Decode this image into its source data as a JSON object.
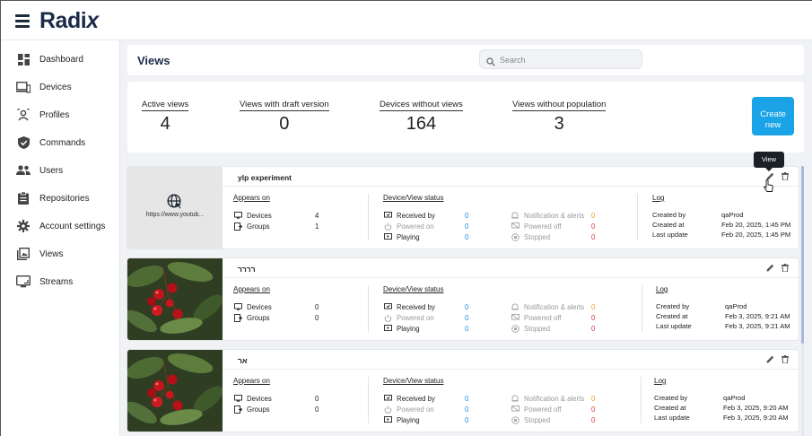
{
  "app": {
    "logo": "Radix"
  },
  "sidebar": {
    "items": [
      {
        "label": "Dashboard",
        "icon": "dashboard-icon"
      },
      {
        "label": "Devices",
        "icon": "devices-icon"
      },
      {
        "label": "Profiles",
        "icon": "profiles-icon"
      },
      {
        "label": "Commands",
        "icon": "shield-check-icon"
      },
      {
        "label": "Users",
        "icon": "users-icon"
      },
      {
        "label": "Repositories",
        "icon": "clipboard-icon"
      },
      {
        "label": "Account settings",
        "icon": "gear-icon"
      },
      {
        "label": "Views",
        "icon": "views-icon"
      },
      {
        "label": "Streams",
        "icon": "streams-icon"
      }
    ]
  },
  "header": {
    "title": "Views",
    "search_placeholder": "Search"
  },
  "stats": [
    {
      "label": "Active views",
      "value": "4"
    },
    {
      "label": "Views with draft version",
      "value": "0"
    },
    {
      "label": "Devices without views",
      "value": "164"
    },
    {
      "label": "Views without population",
      "value": "3"
    }
  ],
  "create_button": {
    "line1": "Create",
    "line2": "new"
  },
  "tooltip": "View",
  "labels": {
    "appears_on": "Appears on",
    "status": "Device/View status",
    "log": "Log",
    "devices": "Devices",
    "groups": "Groups",
    "received_by": "Received by",
    "powered_on": "Powered on",
    "playing": "Playing",
    "notification": "Notification & alerts",
    "powered_off": "Powered off",
    "stopped": "Stopped",
    "created_by": "Created by",
    "created_at": "Created at",
    "last_update": "Last update"
  },
  "cards": [
    {
      "title": "ylp experiment",
      "thumb_text": "https://www.youtub...",
      "devices": "4",
      "groups": "1",
      "received_by": "0",
      "powered_on": "0",
      "playing": "0",
      "notification": "0",
      "powered_off": "0",
      "stopped": "0",
      "created_by": "qaProd",
      "created_at": "Feb 20, 2025, 1:45 PM",
      "last_update": "Feb 20, 2025, 1:45 PM"
    },
    {
      "title": "רררר",
      "devices": "0",
      "groups": "0",
      "received_by": "0",
      "powered_on": "0",
      "playing": "0",
      "notification": "0",
      "powered_off": "0",
      "stopped": "0",
      "created_by": "qaProd",
      "created_at": "Feb 3, 2025, 9:21 AM",
      "last_update": "Feb 3, 2025, 9:21 AM"
    },
    {
      "title": "אר",
      "devices": "0",
      "groups": "0",
      "received_by": "0",
      "powered_on": "0",
      "playing": "0",
      "notification": "0",
      "powered_off": "0",
      "stopped": "0",
      "created_by": "qaProd",
      "created_at": "Feb 3, 2025, 9:20 AM",
      "last_update": "Feb 3, 2025, 9:20 AM"
    }
  ]
}
